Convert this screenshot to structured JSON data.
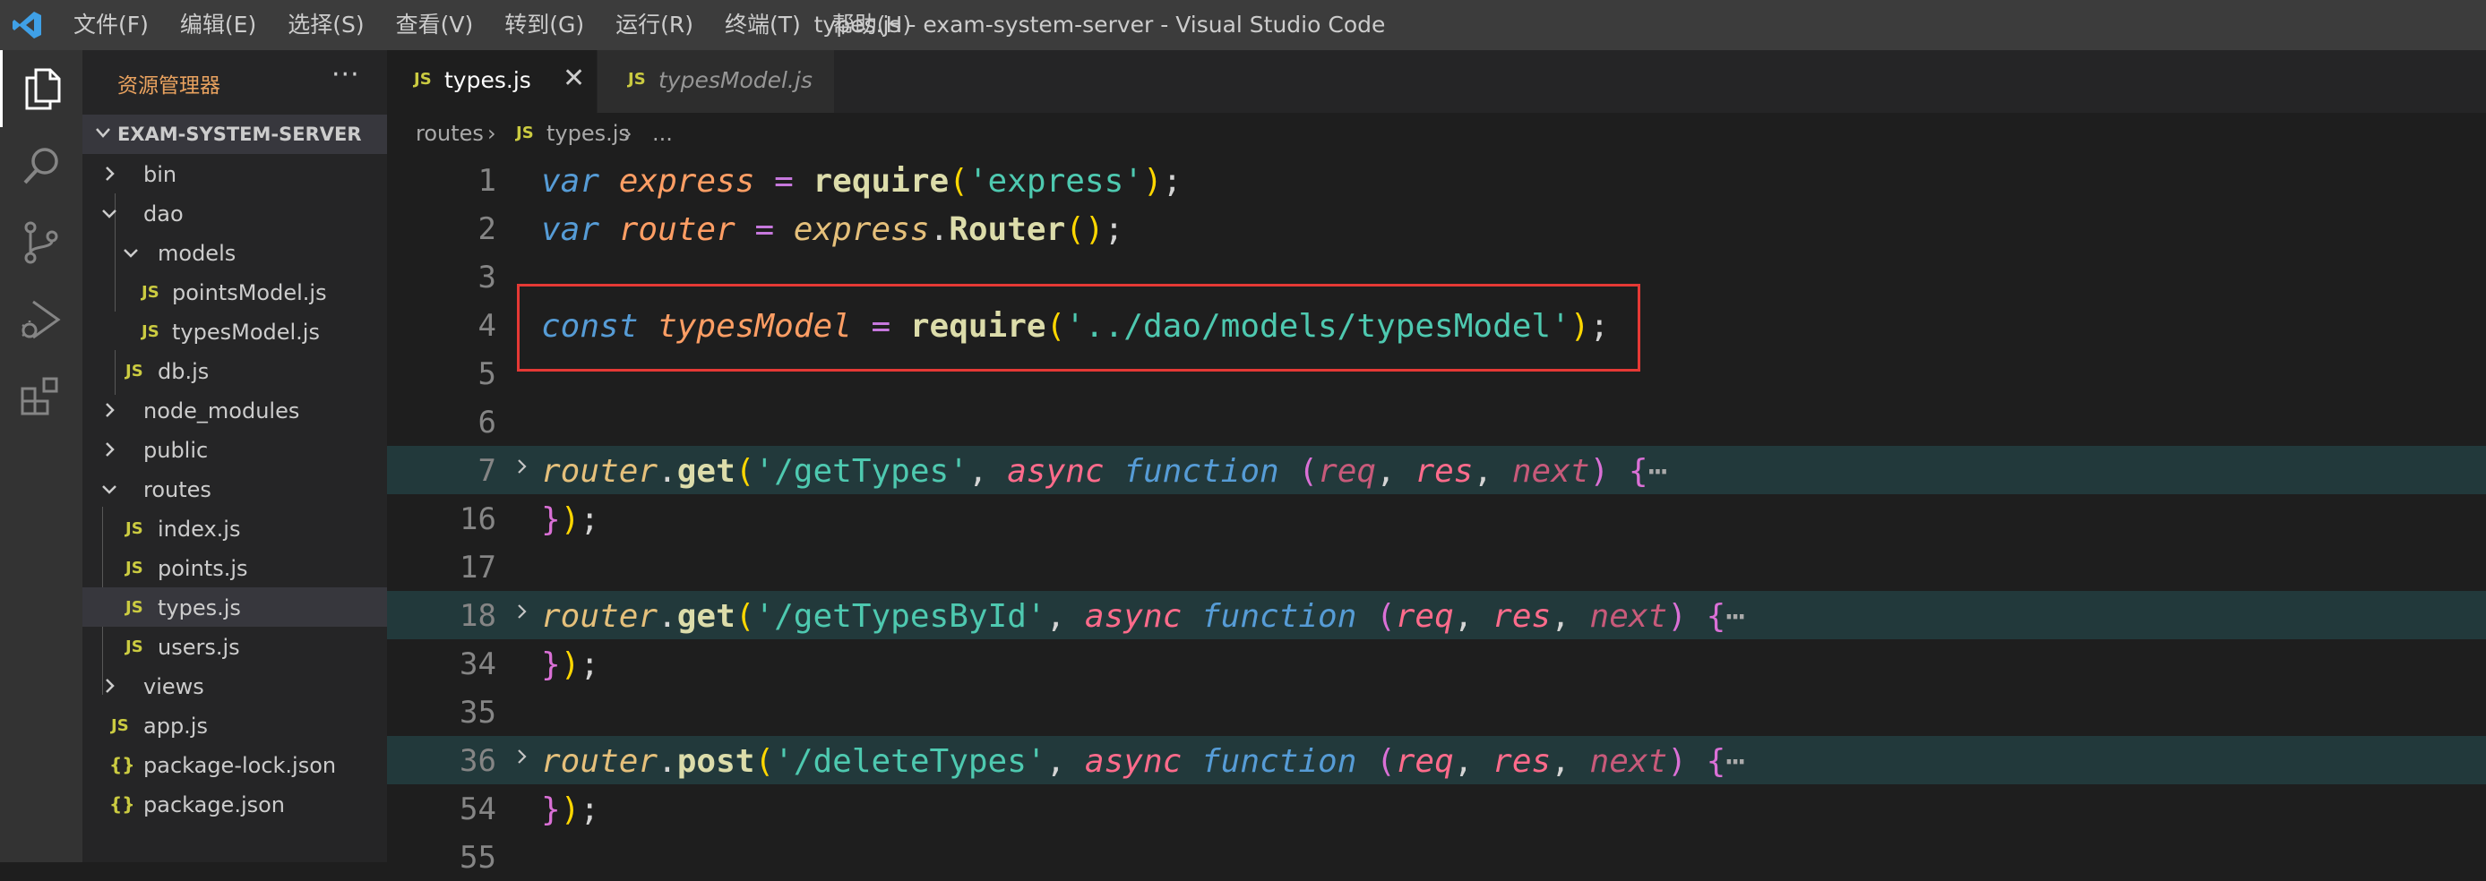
{
  "title_bar": {
    "menu": [
      "文件(F)",
      "编辑(E)",
      "选择(S)",
      "查看(V)",
      "转到(G)",
      "运行(R)",
      "终端(T)",
      "帮助(H)"
    ],
    "window_title": "types.js - exam-system-server - Visual Studio Code"
  },
  "activity_bar": {
    "icons": [
      "explorer-icon",
      "search-icon",
      "source-control-icon",
      "run-debug-icon",
      "extensions-icon"
    ]
  },
  "sidebar": {
    "title": "资源管理器",
    "more": "···",
    "section": "EXAM-SYSTEM-SERVER",
    "tree": [
      {
        "label": "bin",
        "kind": "folder",
        "expanded": false
      },
      {
        "label": "dao",
        "kind": "folder",
        "expanded": true
      },
      {
        "label": "models",
        "kind": "folder",
        "expanded": true
      },
      {
        "label": "pointsModel.js",
        "kind": "js",
        "badge": "JS"
      },
      {
        "label": "typesModel.js",
        "kind": "js",
        "badge": "JS"
      },
      {
        "label": "db.js",
        "kind": "js",
        "badge": "JS"
      },
      {
        "label": "node_modules",
        "kind": "folder",
        "expanded": false
      },
      {
        "label": "public",
        "kind": "folder",
        "expanded": false
      },
      {
        "label": "routes",
        "kind": "folder",
        "expanded": true
      },
      {
        "label": "index.js",
        "kind": "js",
        "badge": "JS"
      },
      {
        "label": "points.js",
        "kind": "js",
        "badge": "JS"
      },
      {
        "label": "types.js",
        "kind": "js",
        "badge": "JS",
        "selected": true
      },
      {
        "label": "users.js",
        "kind": "js",
        "badge": "JS"
      },
      {
        "label": "views",
        "kind": "folder",
        "expanded": false
      },
      {
        "label": "app.js",
        "kind": "js",
        "badge": "JS"
      },
      {
        "label": "package-lock.json",
        "kind": "json",
        "badge": "{}"
      },
      {
        "label": "package.json",
        "kind": "json",
        "badge": "{}"
      }
    ]
  },
  "tabs": [
    {
      "badge": "JS",
      "name": "types.js",
      "close": "✕",
      "active": true
    },
    {
      "badge": "JS",
      "name": "typesModel.js",
      "active": false
    }
  ],
  "breadcrumb": {
    "folder": "routes",
    "sep": "›",
    "file_badge": "JS",
    "file": "types.js",
    "sep2": "›",
    "tail": "..."
  },
  "code": {
    "line_numbers": [
      "1",
      "2",
      "3",
      "4",
      "5",
      "6",
      "7",
      "16",
      "17",
      "18",
      "34",
      "35",
      "36",
      "54",
      "55"
    ],
    "tokens": {
      "var": "var",
      "express": "express",
      "eq": " = ",
      "require": "require",
      "express_str": "'express'",
      "router": "router",
      "Router": "Router",
      "const": "const",
      "typesModel": "typesModel",
      "typesModel_path": "'../dao/models/typesModel'",
      "get": "get",
      "post": "post",
      "getTypes": "'/getTypes'",
      "getTypesById": "'/getTypesById'",
      "deleteTypes": "'/deleteTypes'",
      "async": "async",
      "function": "function",
      "req": "req",
      "res": "res",
      "next": "next",
      "ellipsis": "⋯"
    }
  },
  "colors": {
    "titlebar": "#3c3c3c",
    "activitybar": "#333333",
    "sidebar": "#252526",
    "editor": "#1e1e1e",
    "folded_line": "#22393b",
    "highlight_border": "#e53935",
    "js_badge": "#cbcb41"
  }
}
